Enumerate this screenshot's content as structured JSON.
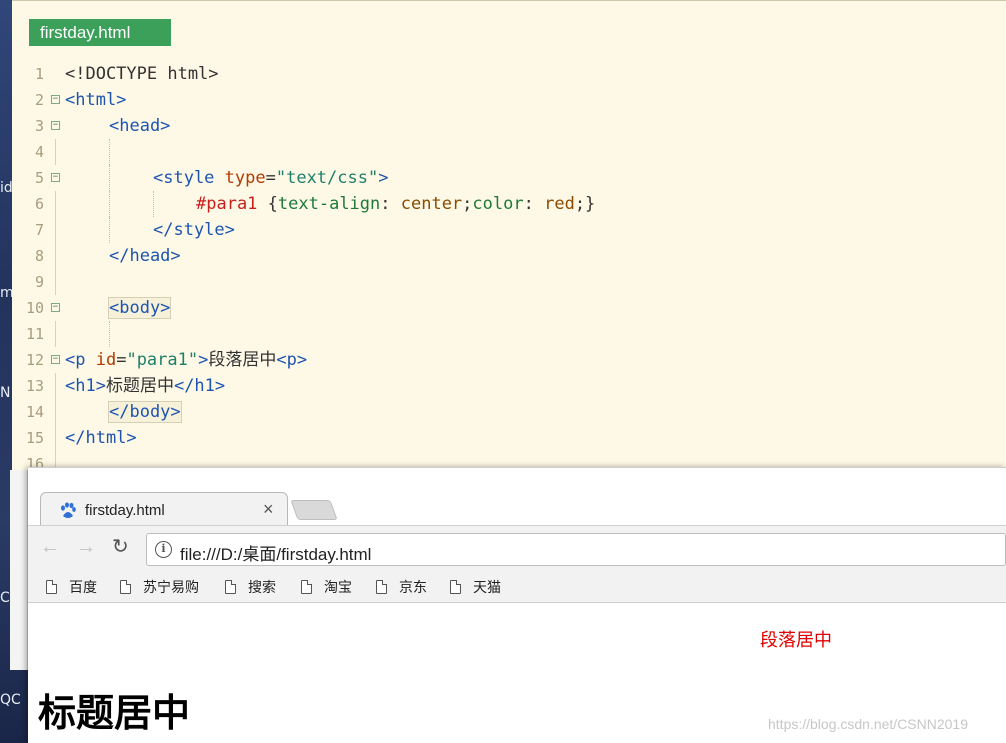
{
  "desktop": {
    "labels": [
      "id",
      "m",
      "N",
      "C",
      "QC"
    ]
  },
  "editor": {
    "tab_title": "firstday.html",
    "line_numbers": [
      "1",
      "2",
      "3",
      "4",
      "5",
      "6",
      "7",
      "8",
      "9",
      "10",
      "11",
      "12",
      "13",
      "14",
      "15",
      "16"
    ],
    "lines": {
      "l1": "<!DOCTYPE html>",
      "l2_tag": "<html>",
      "l3_tag": "<head>",
      "l5_open": "<style ",
      "l5_attr": "type",
      "l5_eq": "=",
      "l5_val": "\"text/css\"",
      "l5_close": ">",
      "l6_sel": "#para1 ",
      "l6_brace": "{",
      "l6_prop1": "text-align",
      "l6_colon1": ": ",
      "l6_val1": "center",
      "l6_semi1": ";",
      "l6_prop2": "color",
      "l6_colon2": ": ",
      "l6_val2": "red",
      "l6_end": ";}",
      "l7_tag": "</style>",
      "l8_tag": "</head>",
      "l10_tag": "<body>",
      "l12_open": "<p ",
      "l12_attr": "id",
      "l12_eq": "=",
      "l12_val": "\"para1\"",
      "l12_gt": ">",
      "l12_text": "段落居中",
      "l12_tag2": "<p>",
      "l13_open": "<h1>",
      "l13_text": "标题居中",
      "l13_close": "</h1>",
      "l14_tag": "</body>",
      "l15_tag": "</html>"
    }
  },
  "browser": {
    "tab_title": "firstday.html",
    "tab_close": "×",
    "url": "file:///D:/桌面/firstday.html",
    "bookmarks": [
      "百度",
      "苏宁易购",
      "搜索",
      "淘宝",
      "京东",
      "天猫"
    ],
    "page": {
      "paragraph": "段落居中",
      "heading": "标题居中"
    },
    "watermark": "https://blog.csdn.net/CSNN2019"
  },
  "colors": {
    "editor_bg": "#fef9e6",
    "tab_green": "#3c9f5a",
    "tag_blue": "#1d54b0",
    "attr_red": "#b33a00",
    "paragraph_red": "#e00000"
  }
}
